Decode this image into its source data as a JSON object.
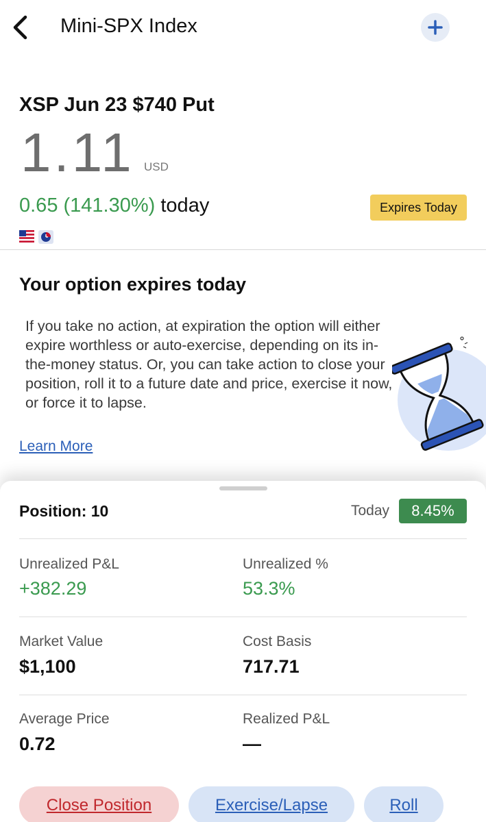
{
  "header": {
    "title": "Mini-SPX Index",
    "back_icon": "chevron-left-icon",
    "add_icon": "plus-icon"
  },
  "quote": {
    "contract": "XSP Jun 23 $740 Put",
    "price": "1.11",
    "currency": "USD",
    "change": "0.65 (141.30%)",
    "change_suffix": "today",
    "expires_badge": "Expires Today",
    "colors": {
      "positive": "#3a9a4f",
      "badge": "#f2cd5c"
    }
  },
  "notice": {
    "title": "Your option expires today",
    "body": "If you take no action, at expiration the option will either expire worthless or auto-exercise, depending on its in-the-money status. Or, you can take action to close your position, roll it to a future date and price, exercise it now, or force it to lapse.",
    "learn_more": "Learn More"
  },
  "position": {
    "label": "Position: 10",
    "today_label": "Today",
    "today_value": "8.45%",
    "stats": {
      "unrealized_pl_label": "Unrealized P&L",
      "unrealized_pl_value": "+382.29",
      "unrealized_pct_label": "Unrealized %",
      "unrealized_pct_value": "53.3%",
      "market_value_label": "Market Value",
      "market_value_value": "$1,100",
      "cost_basis_label": "Cost Basis",
      "cost_basis_value": "717.71",
      "avg_price_label": "Average Price",
      "avg_price_value": "0.72",
      "realized_pl_label": "Realized P&L",
      "realized_pl_value": "—"
    }
  },
  "actions": {
    "close": "Close Position",
    "exercise": "Exercise/Lapse",
    "roll": "Roll"
  }
}
